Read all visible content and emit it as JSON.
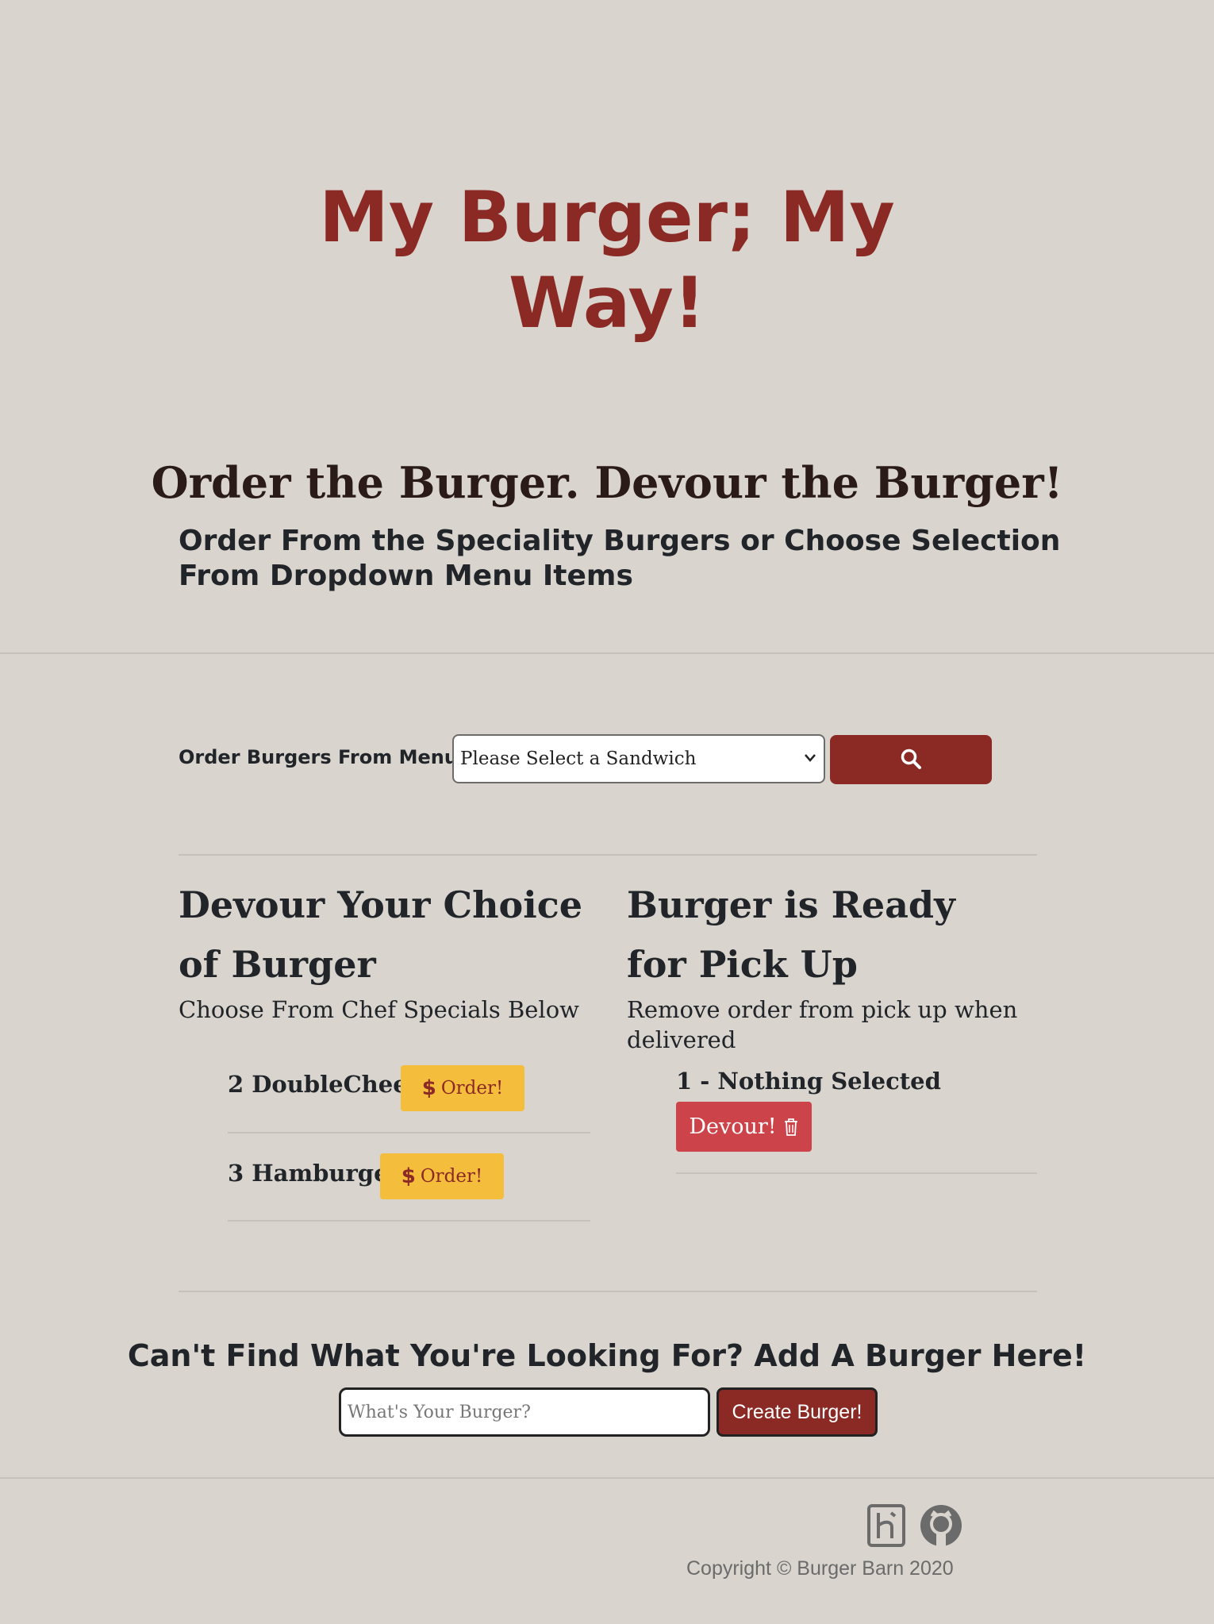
{
  "hero": {
    "title": "My Burger; My Way!"
  },
  "intro": {
    "tagline": "Order the Burger. Devour the Burger!",
    "subtitle": "Order From the Speciality Burgers or Choose Selection From Dropdown Menu Items"
  },
  "menu": {
    "label": "Order Burgers From Menu",
    "select_value": "Please Select a Sandwich",
    "search_icon": "search-icon"
  },
  "specials": {
    "title": "Devour Your Choice of Burger",
    "subtitle": "Choose From Chef Specials Below",
    "items": [
      {
        "name": "2 DoubleCheez",
        "button": "Order!"
      },
      {
        "name": "3 Hamburger",
        "button": "Order!"
      }
    ],
    "button_icon": "dollar-icon"
  },
  "pickup": {
    "title": "Burger is Ready for Pick Up",
    "subtitle": "Remove order from pick up when delivered",
    "items": [
      {
        "name": "1 - Nothing Selected",
        "button": "Devour!"
      }
    ],
    "button_icon": "trash-icon"
  },
  "add": {
    "title": "Can't Find What You're Looking For? Add A Burger Here!",
    "placeholder": "What's Your Burger?",
    "button": "Create Burger!"
  },
  "footer": {
    "icons": [
      "heroku-icon",
      "github-icon"
    ],
    "copyright": "Copyright © Burger Barn 2020"
  },
  "colors": {
    "background": "#d9d5ce",
    "brand_red": "#8b2a25",
    "order_yellow": "#f4bd3c",
    "devour_red": "#cc444a"
  }
}
